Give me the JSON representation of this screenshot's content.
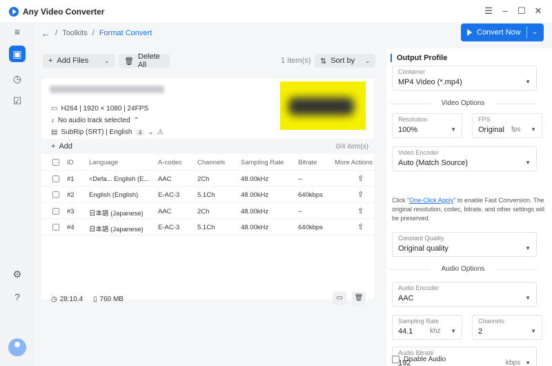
{
  "app": {
    "title": "Any Video Converter"
  },
  "window_controls": {
    "menu": "☰",
    "minimize": "–",
    "maximize": "☐",
    "close": "✕"
  },
  "breadcrumb": {
    "back": "←",
    "sep": "/",
    "toolkits": "Toolkits",
    "current": "Format Convert"
  },
  "convert_button": {
    "label": "Convert Now",
    "caret": "⌄"
  },
  "toolbar": {
    "add_files": "Add Files",
    "delete_all": "Delete All",
    "item_count": "1 Item(s)",
    "sort_by": "Sort by"
  },
  "file": {
    "video_info": "H264 | 1920 × 1080 | 24FPS",
    "audio_info": "No audio track selected",
    "subtitle_info": "SubRip (SRT) | English",
    "subtitle_count": "4",
    "duration": "28:10.4",
    "size": "760 MB"
  },
  "tracks": {
    "add_label": "Add",
    "count": "0/4 item(s)",
    "columns": [
      "ID",
      "Language",
      "A-codec",
      "Channels",
      "Sampling Rate",
      "Bitrate",
      "More Actions"
    ],
    "rows": [
      {
        "id": "#1",
        "language": "<Defa... English (E...",
        "codec": "AAC",
        "channels": "2Ch",
        "rate": "48.00kHz",
        "bitrate": "--"
      },
      {
        "id": "#2",
        "language": "English (English)",
        "codec": "E-AC-3",
        "channels": "5.1Ch",
        "rate": "48.00kHz",
        "bitrate": "640kbps"
      },
      {
        "id": "#3",
        "language": "日本語 (Japanese)",
        "codec": "AAC",
        "channels": "2Ch",
        "rate": "48.00kHz",
        "bitrate": "--"
      },
      {
        "id": "#4",
        "language": "日本語 (Japanese)",
        "codec": "E-AC-3",
        "channels": "5.1Ch",
        "rate": "48.00kHz",
        "bitrate": "640kbps"
      }
    ]
  },
  "output": {
    "title": "Output Profile",
    "container_label": "Container",
    "container_value": "MP4 Video (*.mp4)",
    "video_options": "Video Options",
    "resolution_label": "Resolution",
    "resolution_value": "100%",
    "fps_label": "FPS",
    "fps_value": "Original",
    "fps_unit": "fps",
    "encoder_label": "Video Encoder",
    "encoder_value": "Auto (Match Source)",
    "hint_pre": "Click \"",
    "hint_link": "One-Click Apply",
    "hint_post": "\" to enable Fast Conversion. The original resolution, codec, bitrate, and other settings will be preserved.",
    "quality_label": "Constant Quality",
    "quality_value": "Original quality",
    "audio_options": "Audio Options",
    "audio_encoder_label": "Audio Encoder",
    "audio_encoder_value": "AAC",
    "sampling_label": "Sampling Rate",
    "sampling_value": "44.1",
    "sampling_unit": "khz",
    "channels_label": "Channels",
    "channels_value": "2",
    "bitrate_label": "Audio Bitrate",
    "bitrate_value": "192",
    "bitrate_unit": "kbps",
    "disable_audio": "Disable Audio"
  },
  "colors": {
    "accent": "#1a73e8",
    "sidebar_bg": "#f3f4f6",
    "main_bg": "#f5f6f8"
  },
  "icons": {
    "menu": "menu-icon",
    "toolbox": "toolbox-icon",
    "history": "clock-icon",
    "tasks": "checklist-icon",
    "settings": "gear-icon",
    "help": "help-icon"
  }
}
